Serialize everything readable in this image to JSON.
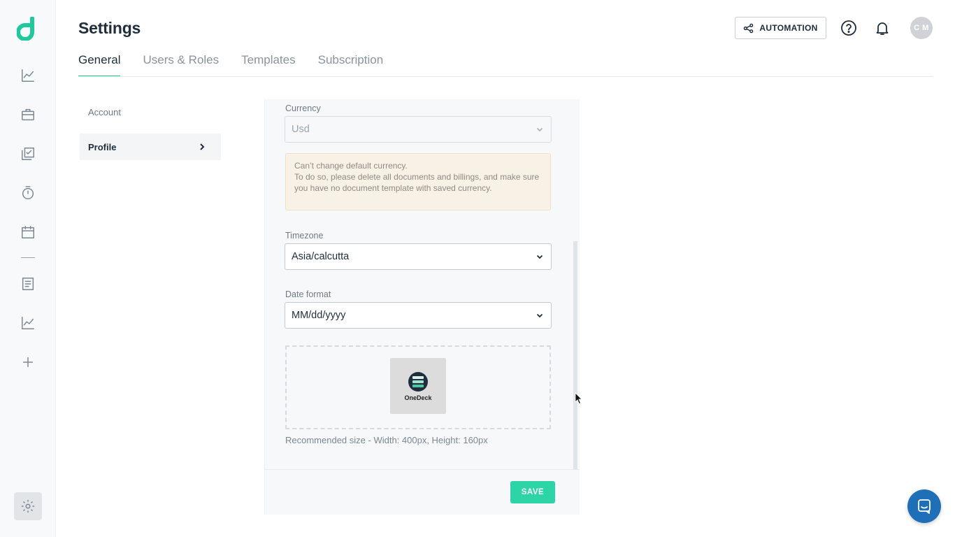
{
  "app": {
    "brand_color": "#20c99b"
  },
  "rail": {
    "items": [
      {
        "icon": "line-chart-icon"
      },
      {
        "icon": "briefcase-icon"
      },
      {
        "icon": "stacked-check-icon"
      },
      {
        "icon": "stopwatch-icon"
      },
      {
        "icon": "calendar-icon"
      },
      {
        "icon": "document-icon"
      },
      {
        "icon": "line-chart-icon"
      },
      {
        "icon": "plus-icon"
      }
    ],
    "settings_icon": "gear-icon"
  },
  "header": {
    "title": "Settings",
    "automation_label": "AUTOMATION",
    "avatar_initials": "C M"
  },
  "tabs": [
    {
      "label": "General",
      "active": true
    },
    {
      "label": "Users & Roles",
      "active": false
    },
    {
      "label": "Templates",
      "active": false
    },
    {
      "label": "Subscription",
      "active": false
    }
  ],
  "submenu": {
    "account": "Account",
    "profile": "Profile"
  },
  "form": {
    "currency": {
      "label": "Currency",
      "value": "Usd",
      "disabled": true
    },
    "currency_warning": {
      "line1": "Can’t change default currency.",
      "line2": "To do so, please delete all documents and billings, and make sure you have no document template with saved currency."
    },
    "timezone": {
      "label": "Timezone",
      "value": "Asia/calcutta"
    },
    "date_format": {
      "label": "Date format",
      "value": "MM/dd/yyyy"
    },
    "logo": {
      "caption": "OneDeck",
      "hint": "Recommended size - Width: 400px, Height: 160px"
    },
    "save_label": "SAVE"
  }
}
